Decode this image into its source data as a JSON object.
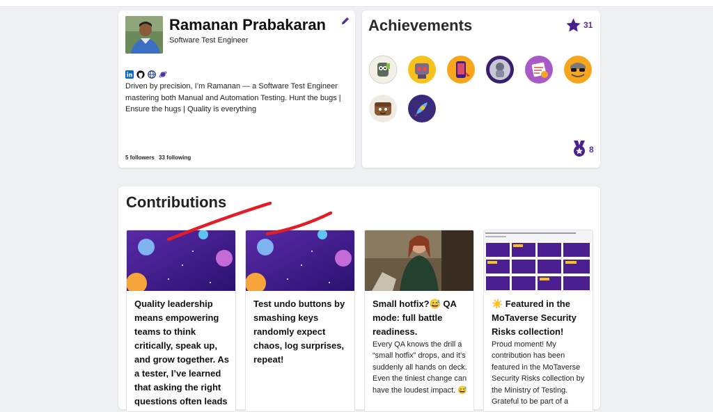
{
  "profile": {
    "name": "Ramanan Prabakaran",
    "role": "Software Test Engineer",
    "bio": "Driven by precision, I’m Ramanan — a Software Test Engineer mastering both Manual and Automation Testing. Hunt the bugs | Ensure the hugs | Quality is everything",
    "followers": "5 followers",
    "following": "33 following",
    "social_icons": [
      "linkedin-icon",
      "github-icon",
      "globe-icon",
      "planet-icon"
    ]
  },
  "achievements": {
    "title": "Achievements",
    "star_count": "31",
    "medal_count": "8",
    "badge_icons": [
      "robot-badge",
      "bot-badge",
      "phone-badge",
      "astronaut-badge",
      "testing-badge",
      "sunglasses-badge",
      "brownie-badge",
      "rocket-badge"
    ]
  },
  "contributions": {
    "title": "Contributions",
    "posts": [
      {
        "title": "Quality leadership means empowering teams to think critically, speak up, and grow together. As a tester, I’ve learned that asking the right questions often leads",
        "body": ""
      },
      {
        "title": "Test undo buttons by smashing keys randomly expect chaos, log surprises, repeat!",
        "body": ""
      },
      {
        "title": "Small hotfix?😅 QA mode: full battle readiness.",
        "body": "Every QA knows the drill a “small hotfix” drops, and it’s suddenly all hands on deck. Even the tiniest change can have the loudest impact. 😅"
      },
      {
        "title": "☀️ Featured in the MoTaverse Security Risks collection!",
        "body": "Proud moment! My contribution has been featured in the MoTaverse Security Risks collection by the Ministry of Testing. Grateful to be part of a"
      }
    ]
  },
  "colors": {
    "accent": "#5a2c9c",
    "scribble": "#e11d27",
    "page_bg": "#eef0f4"
  }
}
